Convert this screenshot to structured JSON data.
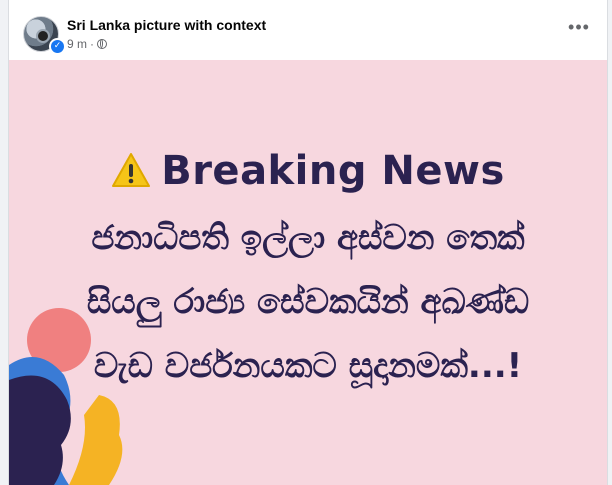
{
  "post": {
    "page_name": "Sri Lanka picture with context",
    "time": "9 m",
    "more_label": "•••"
  },
  "image": {
    "headline": "Breaking News",
    "lines": [
      "ජනාධිපති ඉල්ලා අස්වන තෙක්",
      "සියලු රාජ්‍ය සේවකයින් අඛණ්ඩ",
      "වැඩ වර්ජනයකට සූදානමක්...!"
    ],
    "colors": {
      "background": "#f7d7df",
      "text": "#2b2250",
      "warning": "#f5c518"
    }
  }
}
